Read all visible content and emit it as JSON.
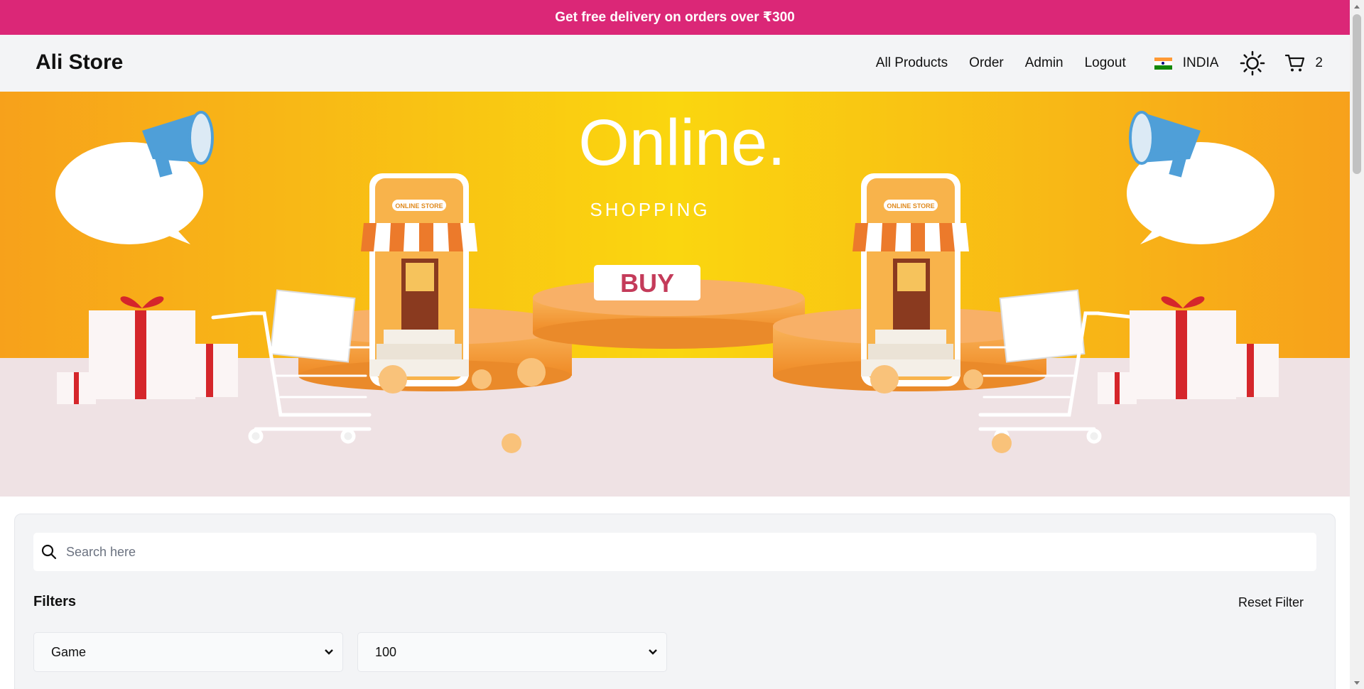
{
  "promo": {
    "text": "Get free delivery on orders over ₹300"
  },
  "header": {
    "brand": "Ali Store",
    "nav": [
      "All Products",
      "Order",
      "Admin",
      "Logout"
    ],
    "country": "INDIA",
    "cart_count": "2",
    "icons": {
      "theme": "sun-icon",
      "cart": "cart-icon",
      "flag": "india-flag-icon"
    }
  },
  "hero": {
    "title": "Online.",
    "subtitle": "SHOPPING",
    "button": "BUY",
    "store_sign": "ONLINE STORE"
  },
  "filters": {
    "search_placeholder": "Search here",
    "title": "Filters",
    "reset": "Reset Filter",
    "category": "Game",
    "price": "100"
  },
  "colors": {
    "promo_bg": "#db2777",
    "header_bg": "#f3f4f6",
    "hero_yellow": "#f9c20f",
    "hero_orange": "#f7a11b",
    "buy_text": "#c43b5a"
  }
}
